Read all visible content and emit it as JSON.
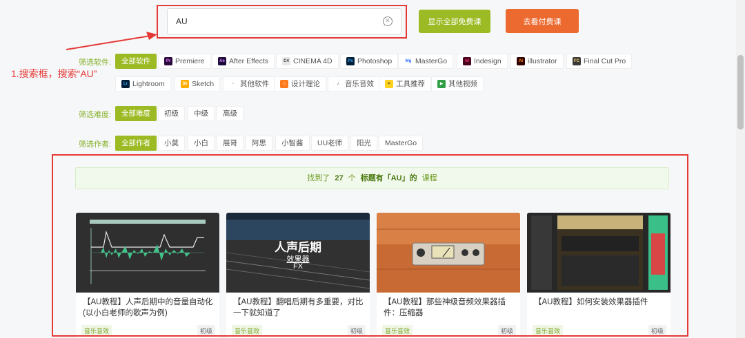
{
  "search": {
    "value": "AU"
  },
  "buttons": {
    "free": "显示全部免费课",
    "paid": "去看付费课"
  },
  "annotation": "1.搜索框，搜索“AU”",
  "filters": {
    "software_label": "筛选软件:",
    "software": [
      "全部软件",
      "Premiere",
      "After Effects",
      "CINEMA 4D",
      "Photoshop",
      "MasterGo",
      "Indesign",
      "illustrator",
      "Final Cut Pro",
      "Lightroom",
      "Sketch",
      "其他软件",
      "设计理论",
      "音乐音效",
      "工具推荐",
      "其他视频"
    ],
    "difficulty_label": "筛选难度:",
    "difficulty": [
      "全部难度",
      "初级",
      "中级",
      "高级"
    ],
    "author_label": "筛选作者:",
    "authors": [
      "全部作者",
      "小莫",
      "小白",
      "展哥",
      "阿思",
      "小智酱",
      "UU老师",
      "阳光",
      "MasterGo"
    ]
  },
  "result_bar": {
    "prefix": "找到了",
    "count": "27",
    "unit": "个",
    "keyword": "标题有「AU」的",
    "suffix": "课程"
  },
  "cards": [
    {
      "title": "【AU教程】人声后期中的音量自动化(以小白老师的歌声为例)",
      "category": "音乐音效",
      "level": "初级"
    },
    {
      "title": "【AU教程】翻唱后期有多重要，对比一下就知道了",
      "category": "音乐音效",
      "level": "初级",
      "thumb_title": "人声后期",
      "thumb_sub1": "效果器",
      "thumb_sub2": "FX"
    },
    {
      "title": "【AU教程】那些神级音频效果器插件：压缩器",
      "category": "音乐音效",
      "level": "初级"
    },
    {
      "title": "【AU教程】如何安装效果器插件",
      "category": "音乐音效",
      "level": "初级"
    }
  ],
  "colors": {
    "accent_green": "#9cba23",
    "accent_orange": "#ec6a2f",
    "annotation_red": "#e53935"
  },
  "icons": {
    "Premiere": "Pr",
    "After Effects": "Ae",
    "CINEMA 4D": "C4",
    "Photoshop": "Ps",
    "MasterGo": "Mg",
    "Indesign": "Id",
    "illustrator": "Ai",
    "Final Cut Pro": "FC",
    "Lightroom": "Lr",
    "Sketch": "Sk",
    "其他软件": "·",
    "设计理论": "□",
    "音乐音效": "♪",
    "工具推荐": "✕",
    "其他视频": "▶"
  }
}
